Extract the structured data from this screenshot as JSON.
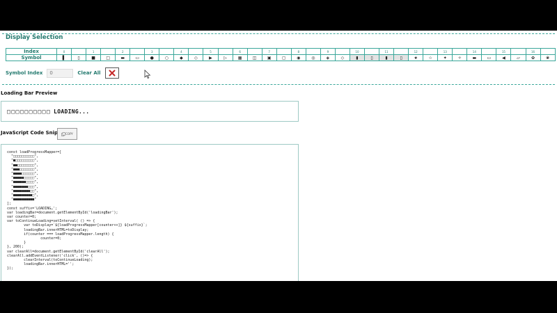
{
  "fieldset": {
    "legend": "Display Selection"
  },
  "table": {
    "index_header": "Index",
    "symbol_header": "Symbol",
    "indices": [
      "0",
      "",
      "1",
      "",
      "2",
      "",
      "3",
      "",
      "4",
      "",
      "5",
      "",
      "6",
      "",
      "7",
      "",
      "8",
      "",
      "9",
      "",
      "10",
      "",
      "11",
      "",
      "12",
      "",
      "13",
      "",
      "14",
      "",
      "15",
      "",
      "16",
      ""
    ],
    "symbols": [
      "▌",
      "▯",
      "■",
      "□",
      "▬",
      "▭",
      "●",
      "○",
      "◆",
      "◇",
      "▶",
      "▷",
      "▦",
      "◫",
      "▣",
      "▢",
      "◉",
      "◎",
      "◈",
      "◇",
      "▮",
      "▯",
      "▮",
      "▯",
      "★",
      "☆",
      "✦",
      "✧",
      "▬",
      "▭",
      "◀",
      "▱",
      "✿",
      "❀"
    ],
    "selected": [
      20,
      21,
      22,
      23
    ]
  },
  "controls": {
    "symbol_index_label": "Symbol Index",
    "symbol_index_value": "0",
    "clear_all_label": "Clear All",
    "clear_icon": "close-icon",
    "clear_icon_color": "#c62828"
  },
  "preview": {
    "title": "Loading Bar Preview",
    "boxes": "□□□□□□□□□□",
    "text": "LOADING..."
  },
  "snippet": {
    "title": "JavaScript Code Snippet",
    "copy_label": "COPY",
    "code": "const loadProgressMapper=[\n  \"□□□□□□□□□□\",\n  \"■□□□□□□□□□\",\n  \"■■□□□□□□□□\",\n  \"■■■□□□□□□□\",\n  \"■■■■□□□□□□\",\n  \"■■■■■□□□□□\",\n  \"■■■■■■□□□□\",\n  \"■■■■■■■□□□\",\n  \"■■■■■■■■□□\",\n  \"■■■■■■■■■□\",\n  \"■■■■■■■■■■\"\n];\nconst suffix='LOADING…';\nvar loadingBar=document.getElementById('loadingBar');\nvar counter=0;\nvar toContinueLoading=setInterval( () => {\n        var toDisplay=`${loadProgressMapper[counter++]} ${suffix}`;\n        loadingBar.innerHTML=toDisplay;\n        if(counter === loadProgressMapper.length) {\n                counter=0;\n        }\n}, 200);\nvar clearAll=document.getElementById('clearAll');\nclearAll.addEventListener('click', ()=> {\n        clearInterval(toContinueLoading);\n        loadingBar.innerHTML='';\n});"
  },
  "colors": {
    "accent": "#247a6f",
    "border": "#3aa79a"
  }
}
